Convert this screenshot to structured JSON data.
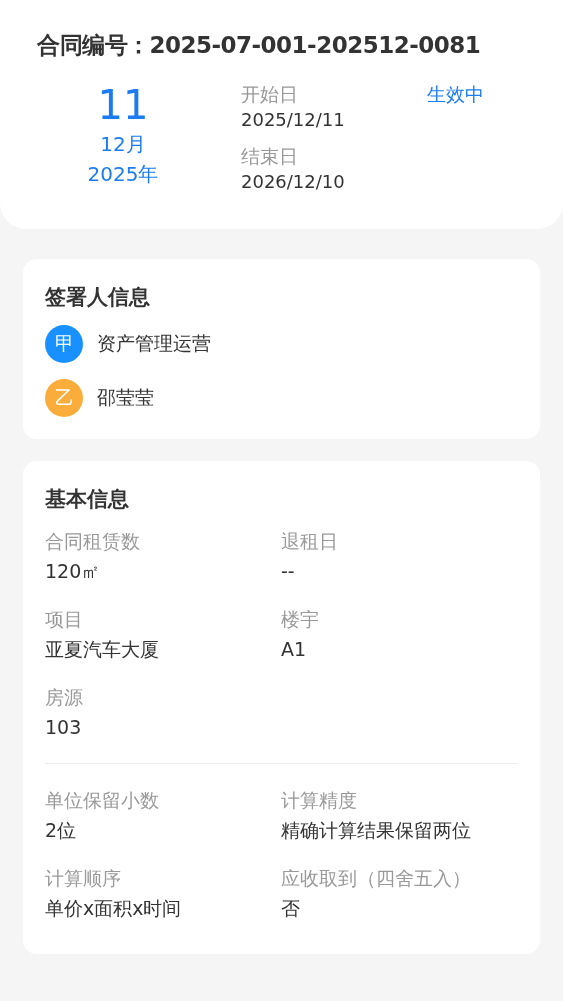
{
  "contract": {
    "label": "合同编号：",
    "number": "2025-07-001-202512-0081",
    "day": "11",
    "month": "12月",
    "year": "2025年",
    "start_label": "开始日",
    "start_date": "2025/12/11",
    "end_label": "结束日",
    "end_date": "2026/12/10",
    "status": "生效中"
  },
  "signers": {
    "title": "签署人信息",
    "items": [
      {
        "badge": "甲",
        "name": "资产管理运营",
        "color": "#1890ff"
      },
      {
        "badge": "乙",
        "name": "邵莹莹",
        "color": "#fbad3b"
      }
    ]
  },
  "basic": {
    "title": "基本信息",
    "sections": [
      [
        {
          "label": "合同租赁数",
          "value": "120㎡"
        },
        {
          "label": "退租日",
          "value": "--"
        },
        {
          "label": "项目",
          "value": "亚夏汽车大厦"
        },
        {
          "label": "楼宇",
          "value": "A1"
        },
        {
          "label": "房源",
          "value": "103"
        }
      ],
      [
        {
          "label": "单位保留小数",
          "value": "2位"
        },
        {
          "label": "计算精度",
          "value": "精确计算结果保留两位"
        },
        {
          "label": "计算顺序",
          "value": "单价x面积x时间"
        },
        {
          "label": "应收取到（四舍五入）",
          "value": "否"
        }
      ]
    ]
  }
}
